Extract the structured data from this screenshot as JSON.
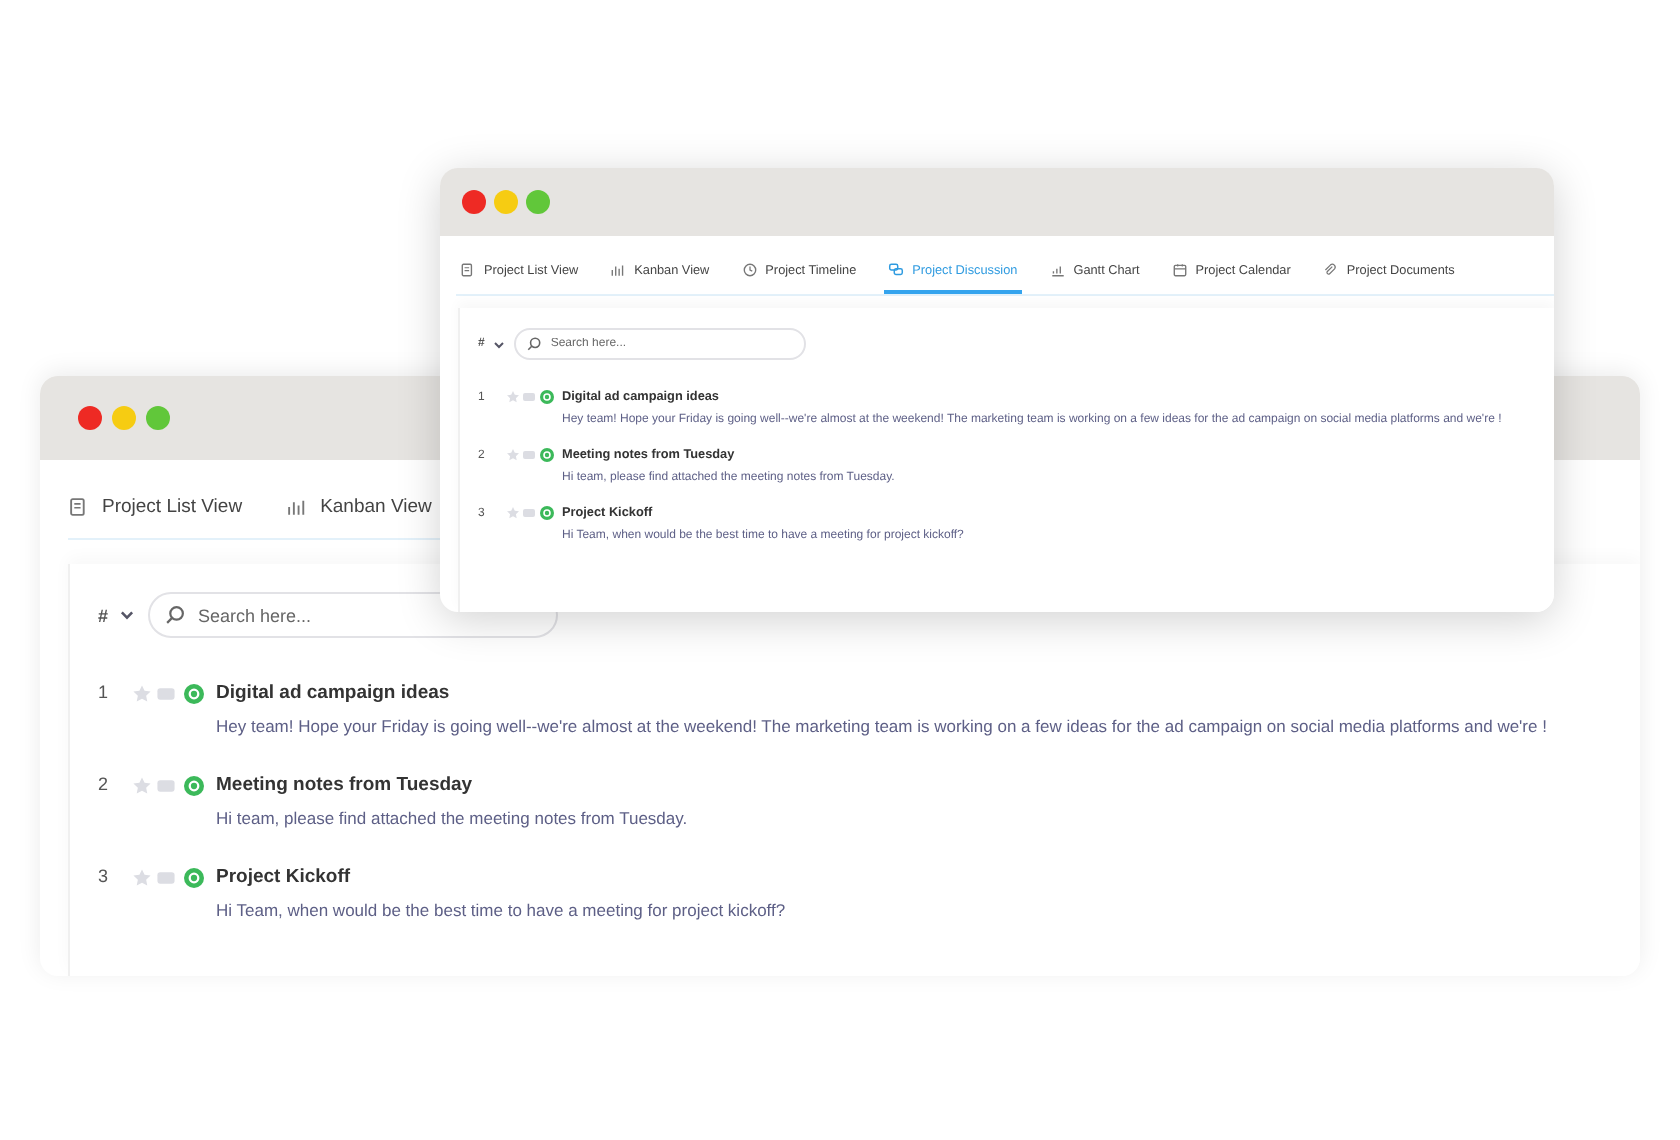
{
  "back_window": {
    "tabs": [
      {
        "label": "Project List View",
        "selected": false
      },
      {
        "label": "Kanban View",
        "selected": false
      }
    ],
    "filter": {
      "label": "#"
    },
    "search": {
      "placeholder": "Search here..."
    },
    "messages": [
      {
        "number": "1",
        "title": "Digital ad campaign ideas",
        "preview": "Hey team! Hope your Friday is going well--we're almost at the weekend! The marketing team is working on a few ideas for the ad campaign on social media platforms and we're !"
      },
      {
        "number": "2",
        "title": "Meeting notes from Tuesday",
        "preview": "Hi team, please find attached the meeting notes from Tuesday."
      },
      {
        "number": "3",
        "title": "Project Kickoff",
        "preview": "Hi Team, when would be the best time to have a meeting for project kickoff?"
      }
    ]
  },
  "front_window": {
    "tabs": [
      {
        "label": "Project List View",
        "selected": false
      },
      {
        "label": "Kanban View",
        "selected": false
      },
      {
        "label": "Project Timeline",
        "selected": false
      },
      {
        "label": "Project Discussion",
        "selected": true
      },
      {
        "label": "Gantt Chart",
        "selected": false
      },
      {
        "label": "Project Calendar",
        "selected": false
      },
      {
        "label": "Project Documents",
        "selected": false
      }
    ],
    "filter": {
      "label": "#"
    },
    "search": {
      "placeholder": "Search here..."
    },
    "messages": [
      {
        "number": "1",
        "title": "Digital ad campaign ideas",
        "preview": "Hey team! Hope your Friday is going well--we're almost at the weekend! The marketing team is working on a few ideas for the ad campaign on social media platforms and we're !"
      },
      {
        "number": "2",
        "title": "Meeting notes from Tuesday",
        "preview": "Hi team, please find attached the meeting notes from Tuesday."
      },
      {
        "number": "3",
        "title": "Project Kickoff",
        "preview": "Hi Team, when would be the best time to have a meeting for project kickoff?"
      }
    ]
  }
}
